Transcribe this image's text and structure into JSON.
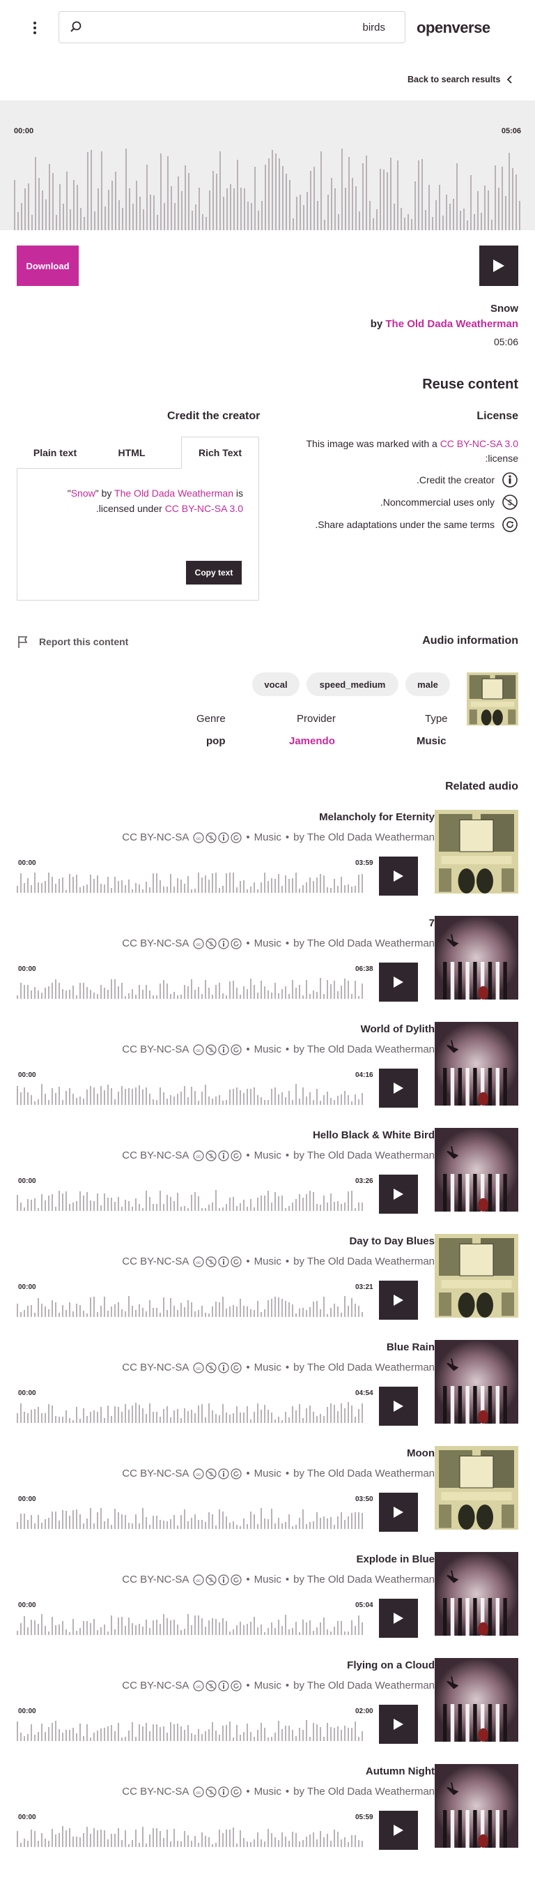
{
  "header": {
    "menu_icon": "dots-vertical-icon",
    "search_placeholder": "",
    "search_term": "birds",
    "brand": "openverse"
  },
  "back_link": "Back to search results",
  "player": {
    "start_time": "00:00",
    "end_time": "05:06",
    "download_label": "Download"
  },
  "audio": {
    "title": "Snow",
    "by": "by",
    "creator": "The Old Dada Weatherman",
    "duration": "05:06"
  },
  "reuse": {
    "heading": "Reuse content",
    "credit_heading": "Credit the creator",
    "tabs": [
      "Plain text",
      "HTML",
      "Rich Text"
    ],
    "active_tab": "Rich Text",
    "attribution": {
      "title": "Snow",
      "q1": "\" by ",
      "creator": "The Old Dada Weatherman",
      "q2": " is\"",
      "licensed": "licensed under ",
      "license": "CC BY-NC-SA 3.0",
      "end": "."
    },
    "copy_label": "Copy text",
    "license_heading": "License",
    "license_text_a": "This image was marked with a ",
    "license_link": "CC BY-NC-SA 3.0",
    "license_text_b": " license:",
    "license_rows": [
      {
        "text": "Credit the creator.",
        "icon": "cc-by-icon"
      },
      {
        "text": "Noncommercial uses only.",
        "icon": "cc-nc-icon"
      },
      {
        "text": "Share adaptations under the same terms.",
        "icon": "cc-sa-icon"
      }
    ]
  },
  "report_label": "Report this content",
  "audio_info": {
    "heading": "Audio information",
    "tags": [
      "vocal",
      "speed_medium",
      "male"
    ],
    "labels": {
      "genre": "Genre",
      "provider": "Provider",
      "type": "Type"
    },
    "values": {
      "genre": "pop",
      "provider": "Jamendo",
      "type": "Music"
    }
  },
  "related": {
    "heading": "Related audio",
    "items": [
      {
        "title": "Melancholy for Eternity",
        "license": "CC BY-NC-SA",
        "category": "Music",
        "by": "by The Old Dada Weatherman",
        "start": "00:00",
        "duration": "03:59",
        "art": "portraits"
      },
      {
        "title": "7",
        "license": "CC BY-NC-SA",
        "category": "Music",
        "by": "by The Old Dada Weatherman",
        "start": "00:00",
        "duration": "06:38",
        "art": "smoke"
      },
      {
        "title": "World of Dylith",
        "license": "CC BY-NC-SA",
        "category": "Music",
        "by": "by The Old Dada Weatherman",
        "start": "00:00",
        "duration": "04:16",
        "art": "smoke"
      },
      {
        "title": "Hello Black & White Bird",
        "license": "CC BY-NC-SA",
        "category": "Music",
        "by": "by The Old Dada Weatherman",
        "start": "00:00",
        "duration": "03:26",
        "art": "smoke"
      },
      {
        "title": "Day to Day Blues",
        "license": "CC BY-NC-SA",
        "category": "Music",
        "by": "by The Old Dada Weatherman",
        "start": "00:00",
        "duration": "03:21",
        "art": "portraits"
      },
      {
        "title": "Blue Rain",
        "license": "CC BY-NC-SA",
        "category": "Music",
        "by": "by The Old Dada Weatherman",
        "start": "00:00",
        "duration": "04:54",
        "art": "smoke"
      },
      {
        "title": "Moon",
        "license": "CC BY-NC-SA",
        "category": "Music",
        "by": "by The Old Dada Weatherman",
        "start": "00:00",
        "duration": "03:50",
        "art": "portraits"
      },
      {
        "title": "Explode in Blue",
        "license": "CC BY-NC-SA",
        "category": "Music",
        "by": "by The Old Dada Weatherman",
        "start": "00:00",
        "duration": "05:04",
        "art": "smoke"
      },
      {
        "title": "Flying on a Cloud",
        "license": "CC BY-NC-SA",
        "category": "Music",
        "by": "by The Old Dada Weatherman",
        "start": "00:00",
        "duration": "02:00",
        "art": "smoke"
      },
      {
        "title": "Autumn Night",
        "license": "CC BY-NC-SA",
        "category": "Music",
        "by": "by The Old Dada Weatherman",
        "start": "00:00",
        "duration": "05:59",
        "art": "smoke"
      }
    ]
  },
  "colors": {
    "accent": "#c52b9b",
    "dark": "#30272e",
    "waveform_bg": "#efeeee",
    "muted": "#6b6269"
  }
}
